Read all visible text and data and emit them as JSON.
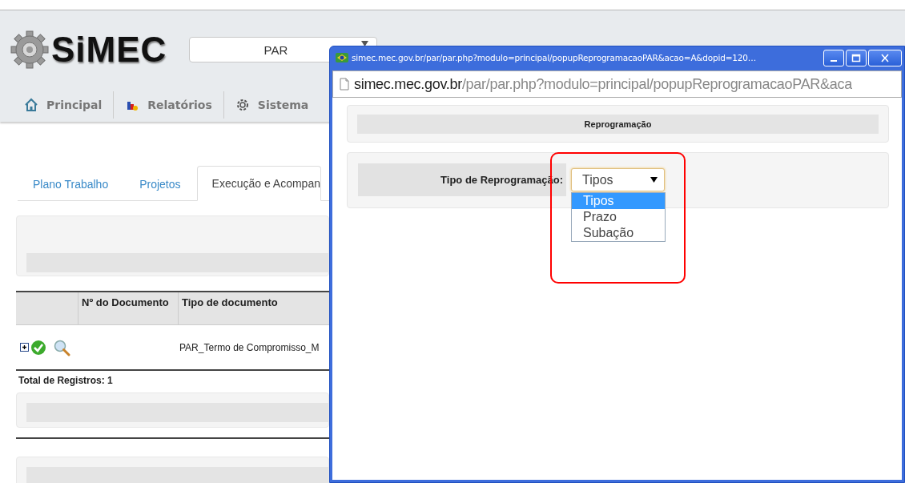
{
  "header": {
    "logo": "SiMEC",
    "module_select": {
      "value": "PAR"
    }
  },
  "nav": [
    {
      "label": "Principal"
    },
    {
      "label": "Relatórios"
    },
    {
      "label": "Sistema"
    }
  ],
  "tabs": [
    {
      "label": "Plano Trabalho",
      "selected": false
    },
    {
      "label": "Projetos",
      "selected": false
    },
    {
      "label": "Execução e Acompan",
      "selected": true
    }
  ],
  "table": {
    "columns": [
      "Nº do Documento",
      "Tipo de documento"
    ],
    "rows": [
      {
        "cells": [
          "",
          "PAR_Termo de Compromisso_M"
        ]
      }
    ],
    "total": "Total de Registros: 1"
  },
  "popup": {
    "title": "simec.mec.gov.br/par/par.php?modulo=principal/popupReprogramacaoPAR&acao=A&dopid=120…",
    "address": {
      "host": "simec.mec.gov.br",
      "path": "/par/par.php?modulo=principal/popupReprogramacaoPAR&aca"
    },
    "heading": "Reprogramação",
    "field": {
      "label": "Tipo de Reprogramação:",
      "value": "Tipos",
      "expanded": true,
      "options": [
        {
          "label": "Tipos",
          "selected": true
        },
        {
          "label": "Prazo",
          "selected": false
        },
        {
          "label": "Subação",
          "selected": false
        }
      ]
    }
  },
  "annotation": {
    "kind": "highlight-box",
    "color": "#ff0000"
  }
}
